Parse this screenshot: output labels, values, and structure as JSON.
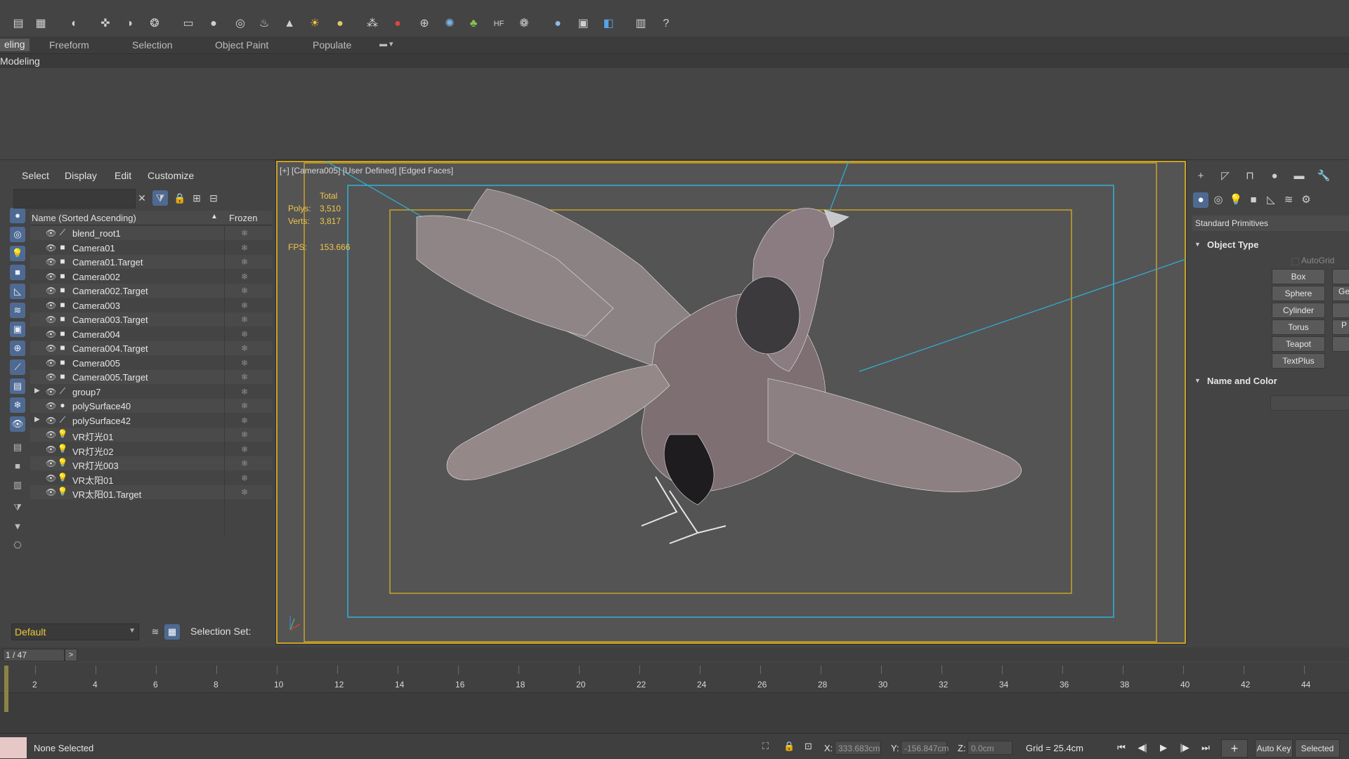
{
  "toolbar": {
    "icons": [
      "layer-explorer-icon",
      "layer-manager-icon",
      "vray-icon",
      "material-icon",
      "render-setup-icon",
      "render-frame-icon",
      "box-icon",
      "sphere-light-icon",
      "target-icon",
      "render-teapot-icon",
      "light-cone-icon",
      "sun-icon",
      "sphere-icon",
      "particle-icon",
      "paint-icon",
      "tree-icon",
      "hair-fur-icon",
      "hf-icon",
      "snapshot-icon",
      "render-icon",
      "render-region-icon",
      "render-active-icon",
      "script-icon",
      "help-icon"
    ]
  },
  "ribbon": {
    "tabs": [
      "eling",
      "Freeform",
      "Selection",
      "Object Paint",
      "Populate"
    ],
    "sub_label": "Modeling"
  },
  "explorer": {
    "menu": [
      "Select",
      "Display",
      "Edit",
      "Customize"
    ],
    "search_placeholder": "",
    "col_name": "Name (Sorted Ascending)",
    "col_sort": "▲",
    "col_frozen": "Frozen",
    "rows": [
      {
        "name": "blend_root1",
        "type": "bone"
      },
      {
        "name": "Camera01",
        "type": "camera"
      },
      {
        "name": "Camera01.Target",
        "type": "camera"
      },
      {
        "name": "Camera002",
        "type": "camera"
      },
      {
        "name": "Camera002.Target",
        "type": "camera"
      },
      {
        "name": "Camera003",
        "type": "camera"
      },
      {
        "name": "Camera003.Target",
        "type": "camera"
      },
      {
        "name": "Camera004",
        "type": "camera"
      },
      {
        "name": "Camera004.Target",
        "type": "camera"
      },
      {
        "name": "Camera005",
        "type": "camera"
      },
      {
        "name": "Camera005.Target",
        "type": "camera"
      },
      {
        "name": "group7",
        "type": "bone",
        "expandable": true
      },
      {
        "name": "polySurface40",
        "type": "geometry"
      },
      {
        "name": "polySurface42",
        "type": "bone",
        "expandable": true
      },
      {
        "name": "VR灯光01",
        "type": "light"
      },
      {
        "name": "VR灯光02",
        "type": "light"
      },
      {
        "name": "VR灯光003",
        "type": "light"
      },
      {
        "name": "VR太阳01",
        "type": "light"
      },
      {
        "name": "VR太阳01.Target",
        "type": "light"
      }
    ],
    "layer": "Default",
    "selection_set_label": "Selection Set:"
  },
  "viewport": {
    "label": "[+] [Camera005] [User Defined] [Edged Faces]",
    "stats": {
      "total_label": "Total",
      "polys_label": "Polys:",
      "polys_value": "3,510",
      "verts_label": "Verts:",
      "verts_value": "3,817",
      "fps_label": "FPS:",
      "fps_value": "153.666"
    },
    "colors": {
      "safe_frame_outer": "#c9a227",
      "safe_frame_cyan": "#2fb2d6",
      "mesh": "#8c7c80"
    }
  },
  "command_panel": {
    "dropdown": "Standard Primitives",
    "object_type_title": "Object Type",
    "autogrid": "AutoGrid",
    "buttons": [
      "Box",
      "Sphere",
      "Cylinder",
      "Torus",
      "Teapot",
      "TextPlus"
    ],
    "buttons_col2": [
      "",
      "Ge",
      "",
      "P",
      "",
      ""
    ],
    "name_color_title": "Name and Color"
  },
  "timeline": {
    "frame": "1 / 47",
    "next": ">",
    "ticks": [
      "2",
      "4",
      "6",
      "8",
      "10",
      "12",
      "14",
      "16",
      "18",
      "20",
      "22",
      "24",
      "26",
      "28",
      "30",
      "32",
      "34",
      "36",
      "38",
      "40",
      "42",
      "44"
    ]
  },
  "status": {
    "selection": "None Selected",
    "x_label": "X:",
    "x_value": "333.683cm",
    "y_label": "Y:",
    "y_value": "-156.847cm",
    "z_label": "Z:",
    "z_value": "0.0cm",
    "grid": "Grid = 25.4cm",
    "auto_key": "Auto Key",
    "selected": "Selected"
  }
}
